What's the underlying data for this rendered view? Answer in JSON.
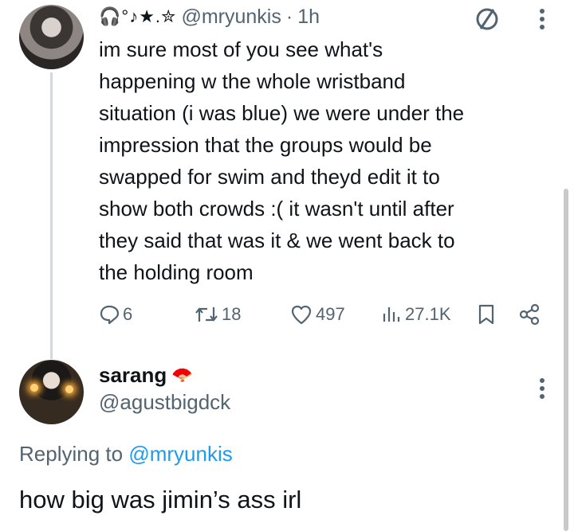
{
  "tweet": {
    "author_decoration": "🎧°♪★.✮",
    "handle": "@mryunkis",
    "separator": "·",
    "time": "1h",
    "text": "im sure most of you see what's\nhappening w the whole wristband\nsituation (i was blue) we were under the\nimpression that the groups would be\nswapped for swim and theyd edit it to\nshow both crowds :( it wasn't until after\nthey said that was it & we went back to\nthe holding room",
    "actions": {
      "replies": "6",
      "retweets": "18",
      "likes": "497",
      "views": "27.1K"
    }
  },
  "reply": {
    "name": "sarang",
    "name_emoji": "🪭",
    "handle": "@agustbigdck",
    "replying_prefix": "Replying to",
    "replying_to": "@mryunkis",
    "text": "how big was jimin’s ass irl"
  },
  "colors": {
    "text": "#0f1419",
    "muted": "#536471",
    "link": "#1d9bf0",
    "thread_line": "#cfd9de"
  },
  "icons": [
    "no-circle-icon",
    "more-icon",
    "reply-icon",
    "retweet-icon",
    "like-icon",
    "views-icon",
    "bookmark-icon",
    "share-icon",
    "fan-emoji"
  ]
}
